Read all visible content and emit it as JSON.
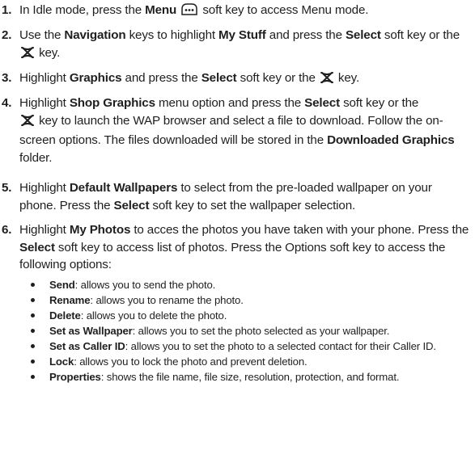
{
  "steps": [
    {
      "num": "1.",
      "a": "In Idle mode, press the ",
      "b1": "Menu",
      "icon": "menu-softkey-icon",
      "c": " soft key to access Menu mode."
    },
    {
      "num": "2.",
      "a": "Use the ",
      "b1": "Navigation",
      "c": " keys to highlight ",
      "b2": "My Stuff",
      "d": " and press the ",
      "b3": "Select",
      "e": " soft key or the ",
      "icon": "select-x-key-icon",
      "f": " key."
    },
    {
      "num": "3.",
      "a": "Highlight ",
      "b1": "Graphics",
      "c": " and press the ",
      "b2": "Select",
      "d": " soft key or the ",
      "icon": "select-x-key-icon",
      "e": " key."
    },
    {
      "num": "4.",
      "a": "Highlight ",
      "b1": "Shop Graphics",
      "c": " menu option and press the ",
      "b2": "Select",
      "d": " soft key or the",
      "icon": "select-x-key-icon",
      "e": " key to launch the WAP browser and select a file to download. Follow the on-screen options. The files downloaded will be stored in the ",
      "b3": "Downloaded Graphics",
      "f": " folder."
    },
    {
      "num": "5.",
      "a": "Highlight ",
      "b1": "Default Wallpapers",
      "c": " to select from the pre-loaded wallpaper on your phone. Press the ",
      "b2": "Select",
      "d": " soft key to set the wallpaper selection."
    },
    {
      "num": "6.",
      "a": "Highlight ",
      "b1": "My Photos",
      "c": " to acces the photos you have taken with your phone. Press the ",
      "b2": "Select",
      "d": " soft key to access list of photos. Press the Options soft key to access the following options:"
    }
  ],
  "options": [
    {
      "term": "Send",
      "desc": ": allows you to send the photo."
    },
    {
      "term": "Rename",
      "desc": ": allows you to rename the photo."
    },
    {
      "term": "Delete",
      "desc": ": allows you to delete the photo."
    },
    {
      "term": "Set as Wallpaper",
      "desc": ": allows you to set the photo selected as your wallpaper."
    },
    {
      "term": "Set as Caller ID",
      "desc": ": allows you to set the photo to a selected contact for their Caller ID."
    },
    {
      "term": "Lock",
      "desc": ": allows you to lock the photo and prevent deletion."
    },
    {
      "term": "Properties",
      "desc": ": shows the file name, file size, resolution, protection, and format."
    }
  ],
  "colors": {
    "text": "#1f1f1f",
    "background": "#ffffff"
  }
}
